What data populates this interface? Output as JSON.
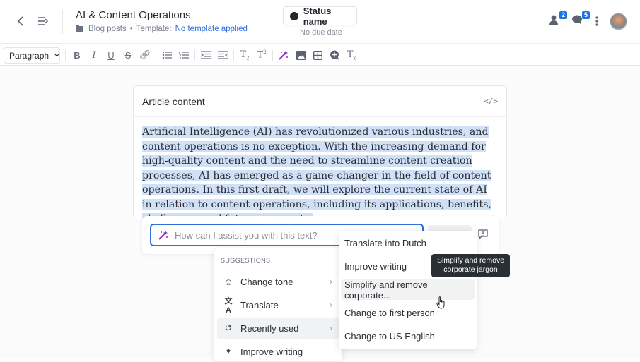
{
  "header": {
    "title": "AI & Content Operations",
    "folder": "Blog posts",
    "template_label": "Template:",
    "template_value": "No template applied",
    "status": "Status name",
    "due": "No due date",
    "assignees_count": "2",
    "comments_count": "5"
  },
  "toolbar": {
    "paragraph": "Paragraph",
    "icons": [
      "bold-icon",
      "italic-icon",
      "underline-icon",
      "strikethrough-icon",
      "link-icon",
      "bullet-list-icon",
      "numbered-list-icon",
      "indent-icon",
      "outdent-icon",
      "subscript-icon",
      "superscript-icon",
      "ai-magic-icon",
      "image-icon",
      "table-icon",
      "comment-icon",
      "clear-format-icon"
    ]
  },
  "card": {
    "title": "Article content",
    "body": "Artificial Intelligence (AI) has revolutionized various industries, and content operations is no exception. With the increasing demand for high-quality content and the need to streamline content creation processes, AI has emerged as a game-changer in the field of content operations. In this first draft, we will explore the current state of AI in relation to content operations, including its applications, benefits, challenges, and future prospects."
  },
  "ai": {
    "placeholder": "How can I assist you with this text?"
  },
  "menu": {
    "heading": "SUGGESTIONS",
    "items": [
      {
        "label": "Change tone",
        "icon": "smiley-icon"
      },
      {
        "label": "Translate",
        "icon": "translate-icon"
      },
      {
        "label": "Recently used",
        "icon": "history-icon"
      },
      {
        "label": "Improve writing",
        "icon": "sparkle-icon"
      }
    ]
  },
  "submenu": {
    "items": [
      "Translate into Dutch",
      "Improve writing",
      "Simplify and remove corporate...",
      "Change to first person",
      "Change to US English"
    ]
  },
  "tooltip": "Simplify and remove corporate jargon",
  "colors": {
    "accent": "#2f6fde",
    "selection": "#cfe0f7",
    "ai_purple": "#8b2fc9"
  }
}
